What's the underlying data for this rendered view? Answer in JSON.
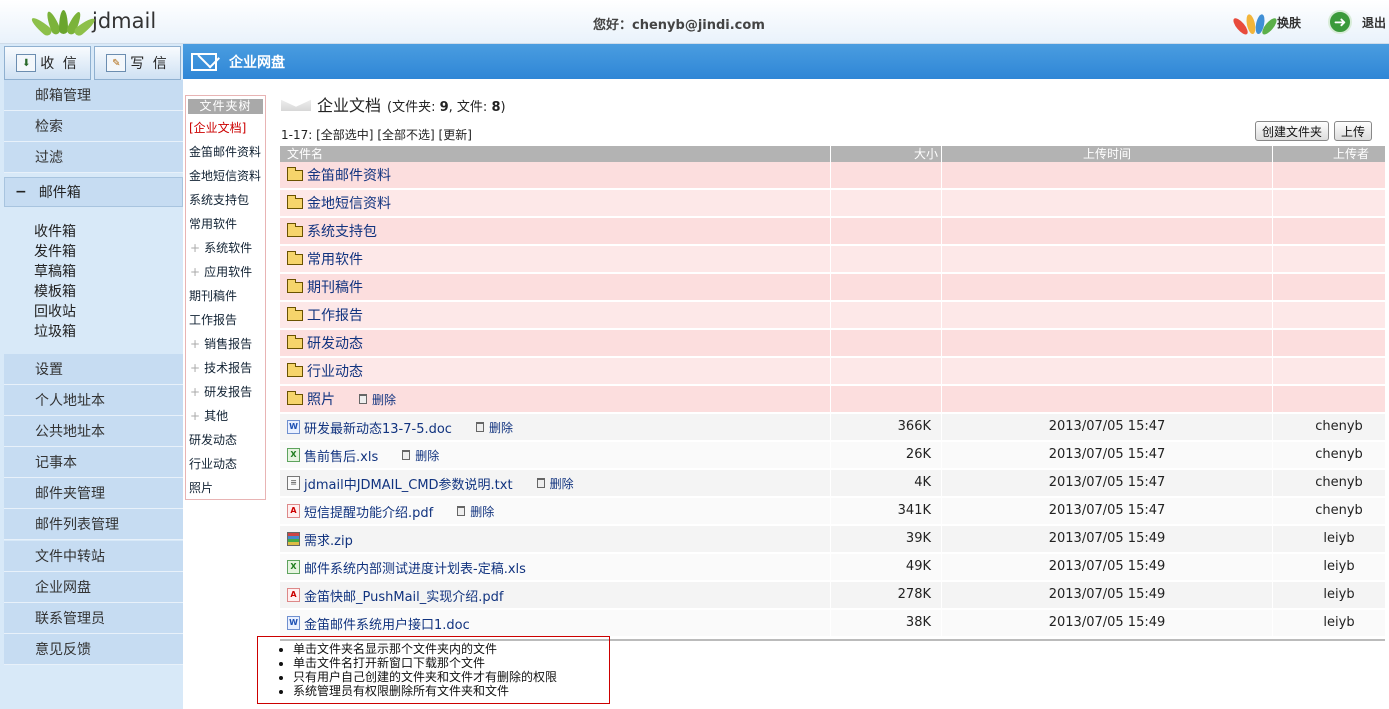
{
  "header": {
    "logo_text": "jdmail",
    "greeting": "您好：chenyb@jindi.com",
    "skin_label": "换肤",
    "logout_label": "退出"
  },
  "sidebar": {
    "receive_label": "收 信",
    "compose_label": "写 信",
    "items_top": [
      "邮箱管理",
      "检索",
      "过滤"
    ],
    "group_label": "邮件箱",
    "folders": [
      "收件箱",
      "发件箱",
      "草稿箱",
      "模板箱",
      "回收站",
      "垃圾箱"
    ],
    "items_bottom": [
      "设置",
      "个人地址本",
      "公共地址本",
      "记事本",
      "邮件夹管理",
      "邮件列表管理",
      "文件中转站",
      "企业网盘",
      "联系管理员",
      "意见反馈"
    ]
  },
  "panel": {
    "title": "企业网盘"
  },
  "tree": {
    "header": "文件夹树",
    "items": [
      {
        "label": "[企业文档]",
        "type": "active"
      },
      {
        "label": "金笛邮件资料",
        "type": "root"
      },
      {
        "label": "金地短信资料",
        "type": "root"
      },
      {
        "label": "系统支持包",
        "type": "root"
      },
      {
        "label": "常用软件",
        "type": "root"
      },
      {
        "label": "系统软件",
        "type": "sub"
      },
      {
        "label": "应用软件",
        "type": "sub"
      },
      {
        "label": "期刊稿件",
        "type": "root"
      },
      {
        "label": "工作报告",
        "type": "root"
      },
      {
        "label": "销售报告",
        "type": "sub"
      },
      {
        "label": "技术报告",
        "type": "sub"
      },
      {
        "label": "研发报告",
        "type": "sub"
      },
      {
        "label": "其他",
        "type": "sub"
      },
      {
        "label": "研发动态",
        "type": "root"
      },
      {
        "label": "行业动态",
        "type": "root"
      },
      {
        "label": "照片",
        "type": "root"
      }
    ]
  },
  "doc": {
    "title": "企业文档",
    "stats_prefix": "(文件夹: ",
    "folder_count": "9",
    "stats_mid": ", 文件: ",
    "file_count": "8",
    "stats_suffix": ")",
    "range": "1-17:",
    "select_all": "[全部选中]",
    "deselect_all": "[全部不选]",
    "refresh": "[更新]",
    "create_folder": "创建文件夹",
    "upload": "上传"
  },
  "table": {
    "headers": {
      "name": "文件名",
      "size": "大小",
      "time": "上传时间",
      "user": "上传者"
    },
    "delete_label": "删除",
    "folders": [
      "金笛邮件资料",
      "金地短信资料",
      "系统支持包",
      "常用软件",
      "期刊稿件",
      "工作报告",
      "研发动态",
      "行业动态",
      "照片"
    ],
    "files": [
      {
        "name": "研发最新动态13-7-5.doc",
        "icon": "doc",
        "size": "366K",
        "time": "2013/07/05 15:47",
        "user": "chenyb",
        "deletable": true
      },
      {
        "name": "售前售后.xls",
        "icon": "xls",
        "size": "26K",
        "time": "2013/07/05 15:47",
        "user": "chenyb",
        "deletable": true
      },
      {
        "name": "jdmail中JDMAIL_CMD参数说明.txt",
        "icon": "txt",
        "size": "4K",
        "time": "2013/07/05 15:47",
        "user": "chenyb",
        "deletable": true
      },
      {
        "name": "短信提醒功能介绍.pdf",
        "icon": "pdf",
        "size": "341K",
        "time": "2013/07/05 15:47",
        "user": "chenyb",
        "deletable": true
      },
      {
        "name": "需求.zip",
        "icon": "zip",
        "size": "39K",
        "time": "2013/07/05 15:49",
        "user": "leiyb",
        "deletable": false
      },
      {
        "name": "邮件系统内部测试进度计划表-定稿.xls",
        "icon": "xls",
        "size": "49K",
        "time": "2013/07/05 15:49",
        "user": "leiyb",
        "deletable": false
      },
      {
        "name": "金笛快邮_PushMail_实现介绍.pdf",
        "icon": "pdf",
        "size": "278K",
        "time": "2013/07/05 15:49",
        "user": "leiyb",
        "deletable": false
      },
      {
        "name": "金笛邮件系统用户接口1.doc",
        "icon": "doc",
        "size": "38K",
        "time": "2013/07/05 15:49",
        "user": "leiyb",
        "deletable": false
      }
    ]
  },
  "notes": [
    "单击文件夹名显示那个文件夹内的文件",
    "单击文件名打开新窗口下载那个文件",
    "只有用户自己创建的文件夹和文件才有删除的权限",
    "系统管理员有权限删除所有文件夹和文件"
  ]
}
